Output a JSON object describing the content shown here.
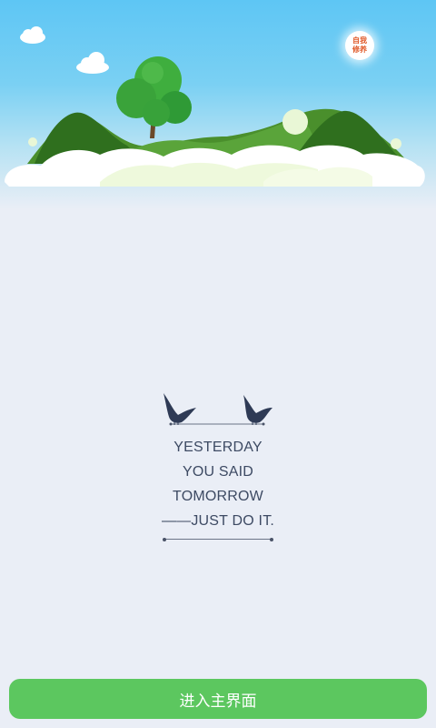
{
  "header": {
    "badge_line1": "自我",
    "badge_line2": "修养",
    "badge_color": "#e05a2a"
  },
  "quote": {
    "lines": [
      "YESTERDAY",
      "YOU SAID",
      "TOMORROW",
      "——JUST DO IT."
    ],
    "text_color": "#3d4a63"
  },
  "footer": {
    "enter_label": "进入主界面",
    "button_color": "#5cc75f"
  }
}
